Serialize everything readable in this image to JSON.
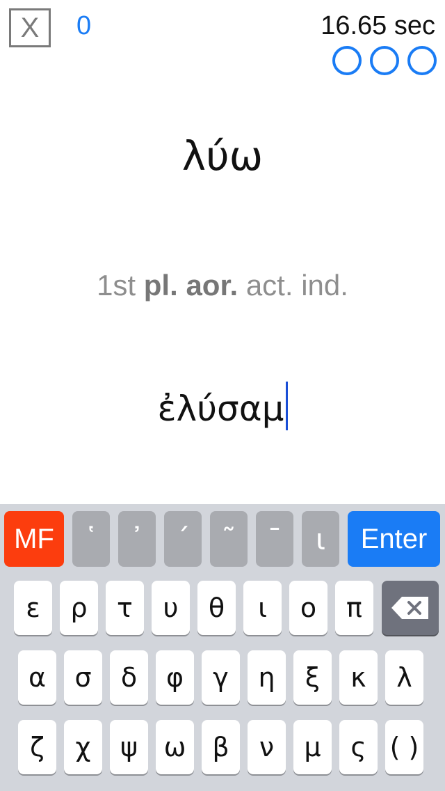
{
  "header": {
    "close_label": "X",
    "score": "0",
    "timer": "16.65 sec",
    "lives": [
      "life",
      "life",
      "life"
    ]
  },
  "prompt": {
    "lemma": "λύω",
    "parse_prefix": "1st ",
    "parse_bold": "pl. aor.",
    "parse_suffix": " act. ind."
  },
  "answer": {
    "value": "ἐλύσαμ"
  },
  "keyboard": {
    "mf_label": "MF",
    "diacritics": [
      "῾",
      "᾿",
      "΄",
      "῀",
      "¯",
      "ι"
    ],
    "enter_label": "Enter",
    "row1": [
      "ε",
      "ρ",
      "τ",
      "υ",
      "θ",
      "ι",
      "ο",
      "π"
    ],
    "row2": [
      "α",
      "σ",
      "δ",
      "φ",
      "γ",
      "η",
      "ξ",
      "κ",
      "λ"
    ],
    "row3": [
      "ζ",
      "χ",
      "ψ",
      "ω",
      "β",
      "ν",
      "μ",
      "ς",
      "( )"
    ],
    "backspace_icon": "backspace-icon"
  },
  "colors": {
    "accent": "#1a7cf5",
    "mf_key": "#fc3d0e",
    "keyboard_bg": "#d2d5db",
    "diacritic_key": "#a9abb0"
  }
}
